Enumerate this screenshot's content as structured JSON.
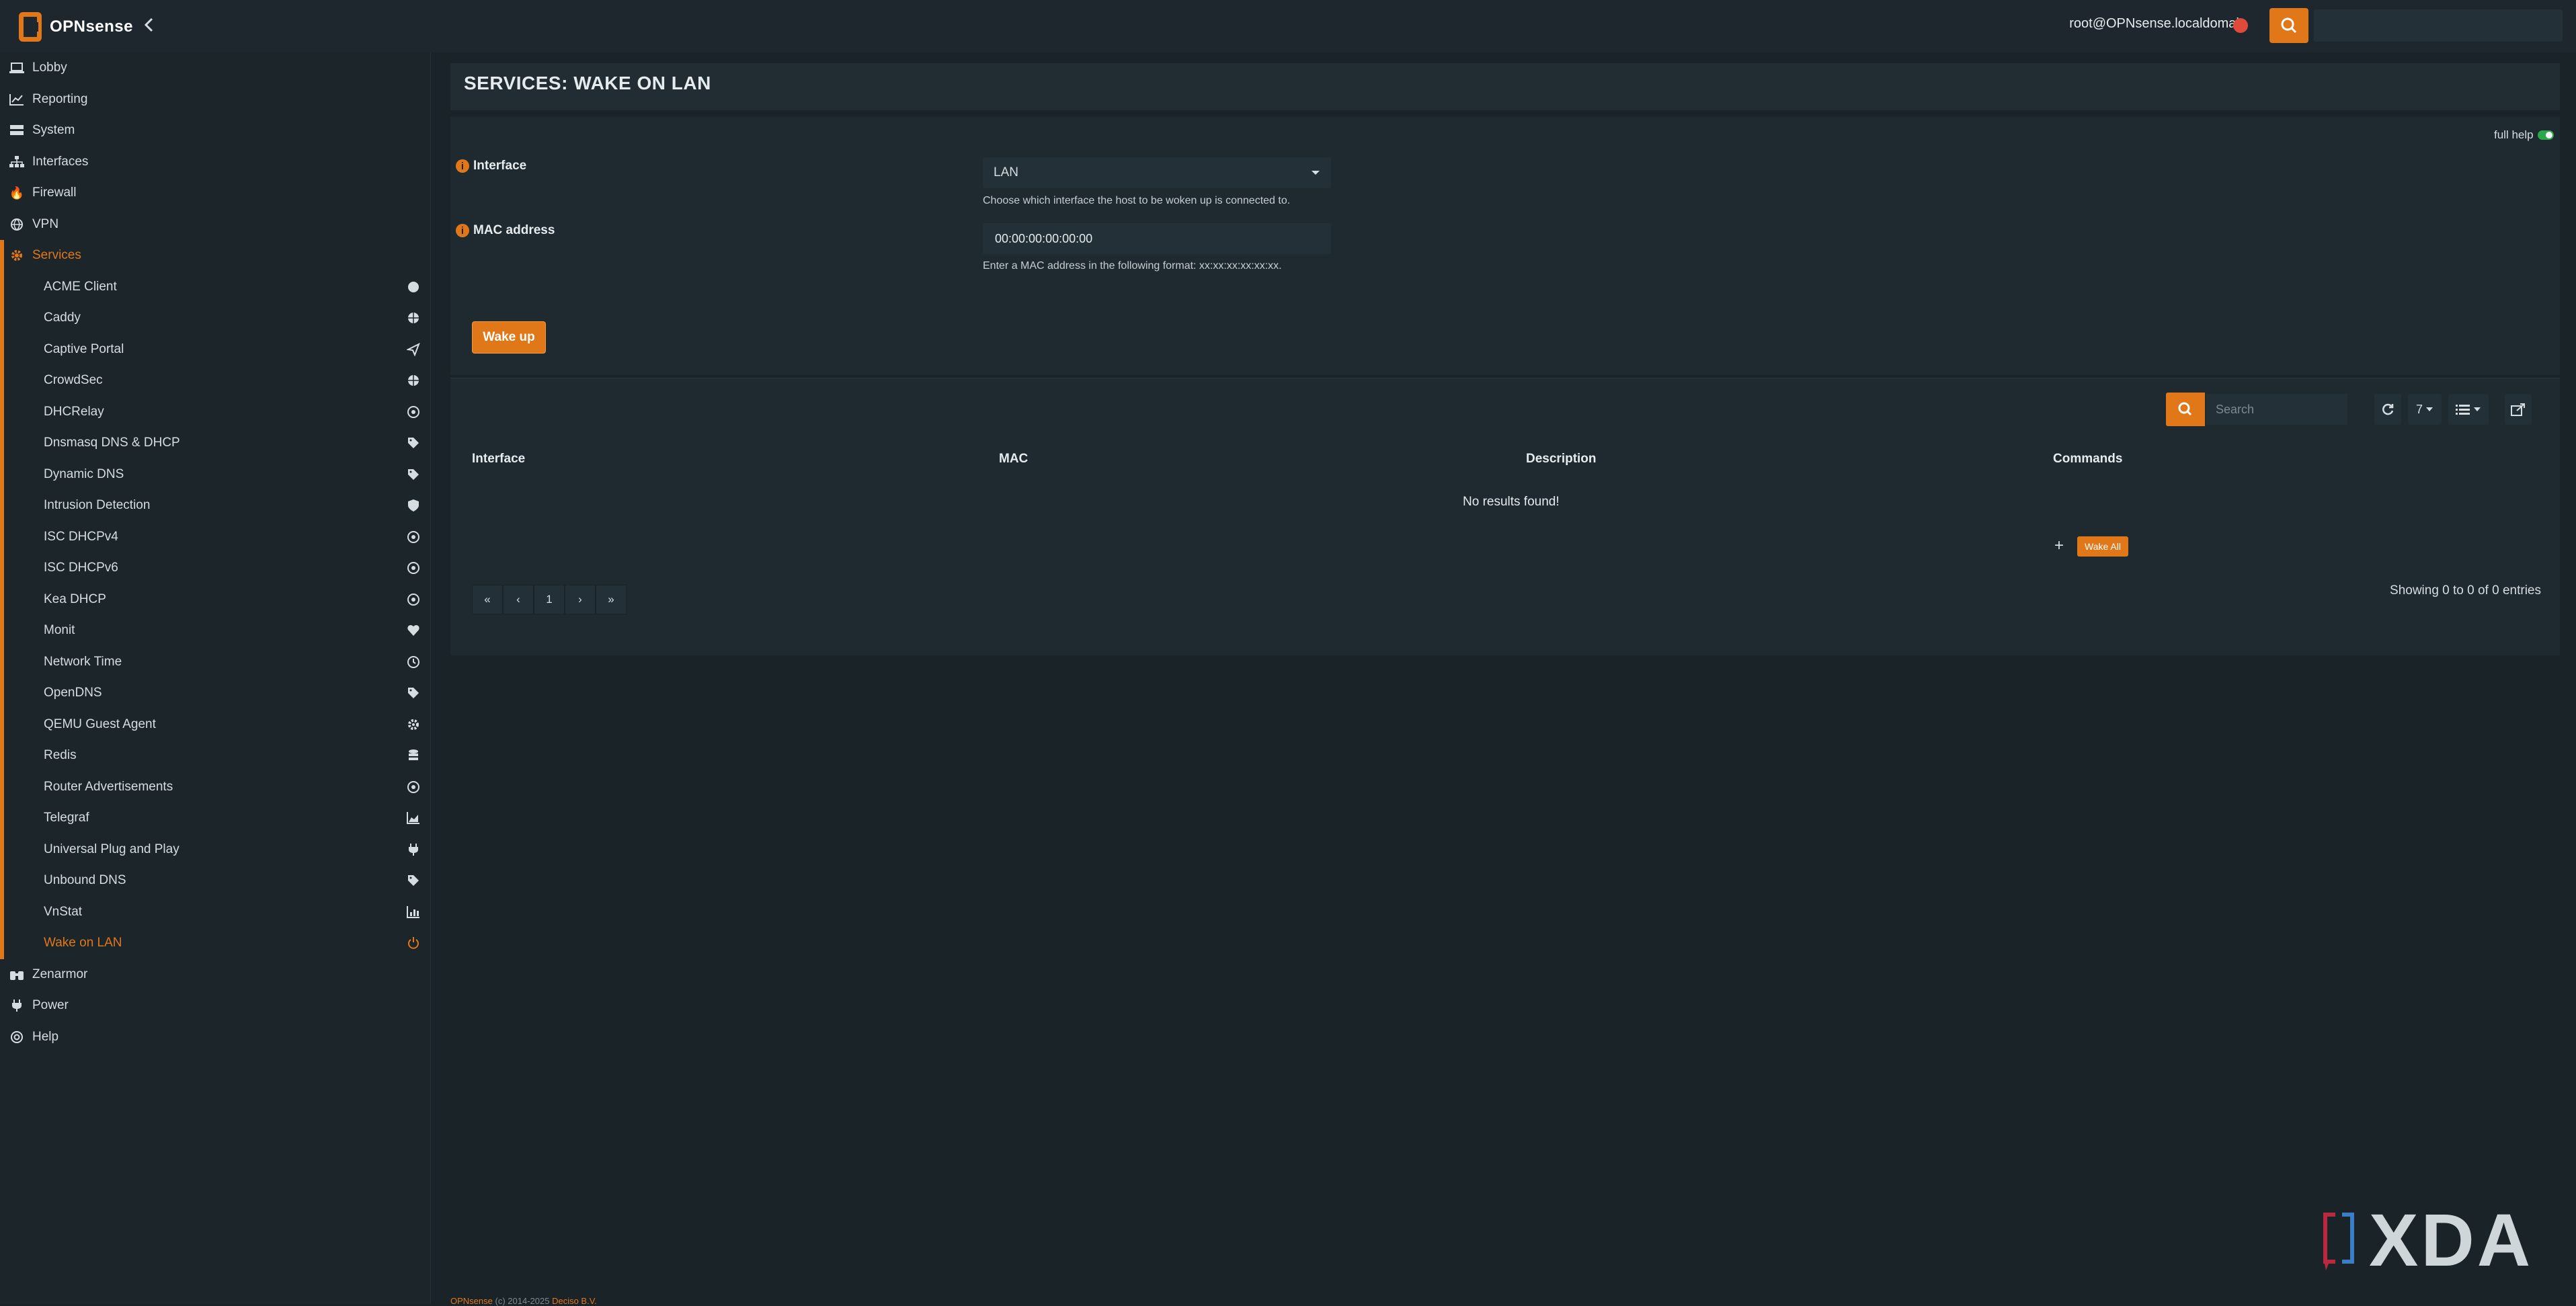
{
  "app": {
    "logo_text": "OPNsense"
  },
  "topbar": {
    "user": "root@OPNsense.localdomain",
    "search_placeholder": ""
  },
  "sidebar": {
    "top_items": [
      {
        "label": "Lobby",
        "icon": "laptop-icon"
      },
      {
        "label": "Reporting",
        "icon": "chart-icon"
      },
      {
        "label": "System",
        "icon": "server-icon"
      },
      {
        "label": "Interfaces",
        "icon": "sitemap-icon"
      },
      {
        "label": "Firewall",
        "icon": "fire-icon"
      },
      {
        "label": "VPN",
        "icon": "globe-icon"
      },
      {
        "label": "Services",
        "icon": "gear-icon"
      }
    ],
    "services": [
      {
        "label": "ACME Client",
        "icon": "certificate-icon"
      },
      {
        "label": "Caddy",
        "icon": "globe-icon"
      },
      {
        "label": "Captive Portal",
        "icon": "paper-plane-icon"
      },
      {
        "label": "CrowdSec",
        "icon": "globe-icon"
      },
      {
        "label": "DHCRelay",
        "icon": "bullseye-icon"
      },
      {
        "label": "Dnsmasq DNS & DHCP",
        "icon": "tags-icon"
      },
      {
        "label": "Dynamic DNS",
        "icon": "tags-icon"
      },
      {
        "label": "Intrusion Detection",
        "icon": "shield-icon"
      },
      {
        "label": "ISC DHCPv4",
        "icon": "bullseye-icon"
      },
      {
        "label": "ISC DHCPv6",
        "icon": "bullseye-icon"
      },
      {
        "label": "Kea DHCP",
        "icon": "bullseye-icon"
      },
      {
        "label": "Monit",
        "icon": "heartbeat-icon"
      },
      {
        "label": "Network Time",
        "icon": "clock-icon"
      },
      {
        "label": "OpenDNS",
        "icon": "tags-icon"
      },
      {
        "label": "QEMU Guest Agent",
        "icon": "gear-icon"
      },
      {
        "label": "Redis",
        "icon": "database-icon"
      },
      {
        "label": "Router Advertisements",
        "icon": "bullseye-icon"
      },
      {
        "label": "Telegraf",
        "icon": "area-chart-icon"
      },
      {
        "label": "Universal Plug and Play",
        "icon": "plug-icon"
      },
      {
        "label": "Unbound DNS",
        "icon": "tags-icon"
      },
      {
        "label": "VnStat",
        "icon": "bar-chart-icon"
      },
      {
        "label": "Wake on LAN",
        "icon": "power-icon"
      }
    ],
    "bottom_items": [
      {
        "label": "Zenarmor",
        "icon": "binoculars-icon"
      },
      {
        "label": "Power",
        "icon": "plug-icon"
      },
      {
        "label": "Help",
        "icon": "lifebuoy-icon"
      }
    ]
  },
  "page": {
    "title": "SERVICES: WAKE ON LAN",
    "full_help": "full help"
  },
  "form": {
    "interface_label": "Interface",
    "interface_value": "LAN",
    "interface_help": "Choose which interface the host to be woken up is connected to.",
    "mac_label": "MAC address",
    "mac_value": "00:00:00:00:00:00",
    "mac_help": "Enter a MAC address in the following format: xx:xx:xx:xx:xx:xx.",
    "wake_button": "Wake up"
  },
  "grid": {
    "search_placeholder": "Search",
    "page_size": "7",
    "columns": [
      "Interface",
      "MAC",
      "Description",
      "Commands"
    ],
    "empty_text": "No results found!",
    "wake_all": "Wake All",
    "pager": [
      "«",
      "‹",
      "1",
      "›",
      "»"
    ],
    "entries_text": "Showing 0 to 0 of 0 entries"
  },
  "footer": {
    "brand": "OPNsense",
    "text": "(c) 2014-2025",
    "company": "Deciso B.V."
  },
  "watermark": {
    "text": "XDA"
  },
  "colors": {
    "accent": "#e0781a",
    "background": "#1a2328",
    "panel": "#1f2a30",
    "status_dot": "#e04a3a"
  }
}
